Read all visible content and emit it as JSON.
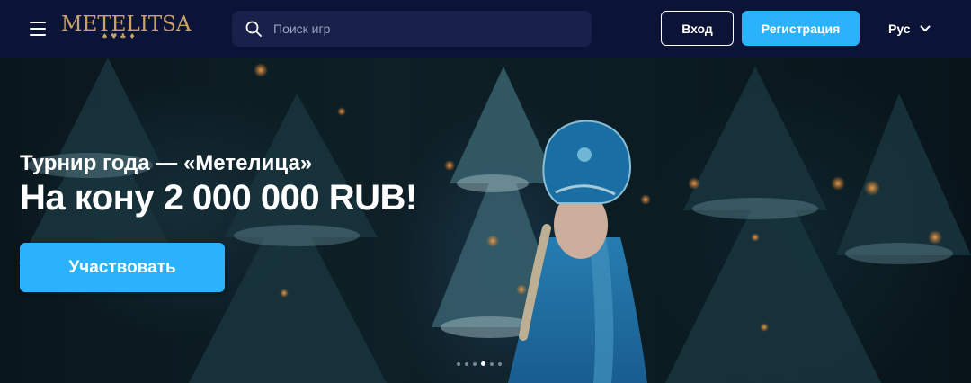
{
  "header": {
    "logo": {
      "text": "METELITSA",
      "suits": "♠♥♣♦"
    },
    "search": {
      "placeholder": "Поиск игр",
      "value": ""
    },
    "login_label": "Вход",
    "register_label": "Регистрация",
    "language": "Рус"
  },
  "hero": {
    "subtitle": "Турнир года — «Метелица»",
    "title": "На кону 2 000 000 RUB!",
    "cta_label": "Участвовать",
    "slides_count": 6,
    "active_slide": 3
  },
  "colors": {
    "header_bg": "#0b1437",
    "search_bg": "#19214a",
    "accent": "#2ab3fc",
    "logo_gold": "#c9a36a"
  },
  "icons": {
    "menu": "hamburger-icon",
    "search": "search-icon",
    "language_toggle": "chevron-down-icon"
  }
}
